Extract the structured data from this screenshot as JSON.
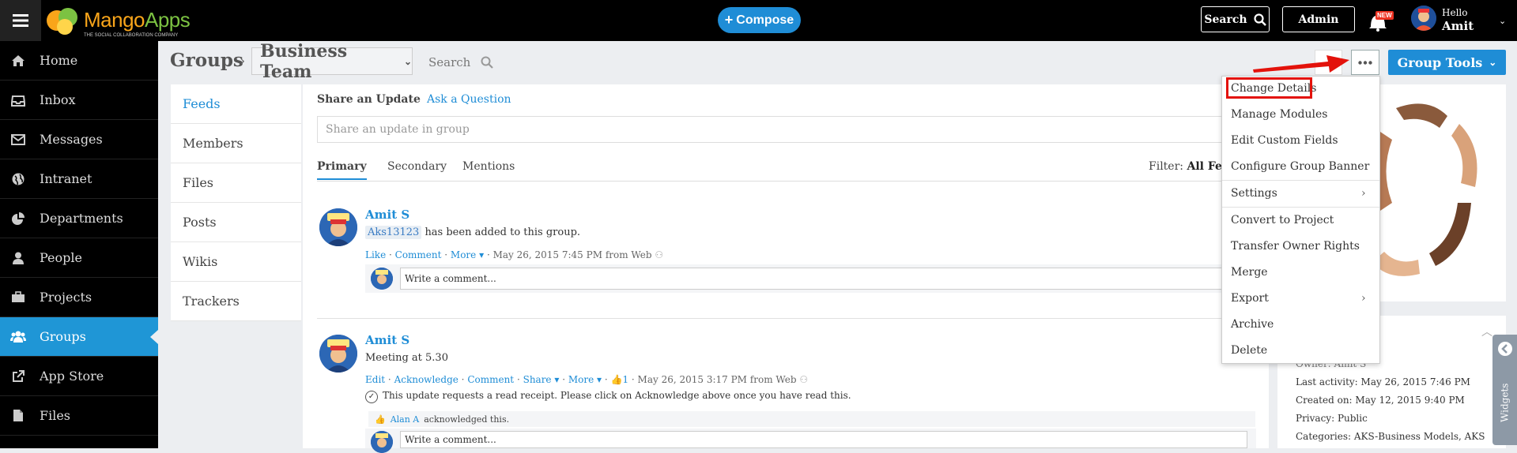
{
  "app": {
    "logo_text_a": "Mango",
    "logo_text_b": "Apps",
    "logo_tagline": "THE SOCIAL COLLABORATION COMPANY",
    "compose_label": "Compose",
    "search_label": "Search",
    "admin_label": "Admin",
    "notification_badge": "NEW",
    "hello": "Hello",
    "user_name": "Amit"
  },
  "sidebar": {
    "items": [
      {
        "label": "Home",
        "icon": "home-icon"
      },
      {
        "label": "Inbox",
        "icon": "inbox-icon"
      },
      {
        "label": "Messages",
        "icon": "envelope-icon"
      },
      {
        "label": "Intranet",
        "icon": "globe-icon"
      },
      {
        "label": "Departments",
        "icon": "pie-chart-icon"
      },
      {
        "label": "People",
        "icon": "person-icon"
      },
      {
        "label": "Projects",
        "icon": "briefcase-icon"
      },
      {
        "label": "Groups",
        "icon": "users-icon"
      },
      {
        "label": "App Store",
        "icon": "external-link-icon"
      },
      {
        "label": "Files",
        "icon": "file-icon"
      }
    ],
    "active": "Groups"
  },
  "header": {
    "breadcrumb_root": "Groups",
    "breadcrumb_sep": "›",
    "group_name": "Business Team",
    "search_label": "Search",
    "group_tools_label": "Group Tools"
  },
  "group_nav": {
    "items": [
      "Feeds",
      "Members",
      "Files",
      "Posts",
      "Wikis",
      "Trackers"
    ]
  },
  "feed": {
    "share_tab": "Share an Update",
    "ask_tab": "Ask a Question",
    "share_placeholder": "Share an update in group",
    "tabs": [
      "Primary",
      "Secondary",
      "Mentions"
    ],
    "filter_label": "Filter:",
    "filter_value": "All Feeds",
    "comment_placeholder": "Write a comment...",
    "posts": [
      {
        "author": "Amit S",
        "tag": "Aks13123",
        "text": "has been added to this group.",
        "actions": [
          "Like",
          "Comment",
          "More"
        ],
        "timestamp": "May 26, 2015 7:45 PM",
        "source": "from Web"
      },
      {
        "author": "Amit S",
        "text": "Meeting at 5.30",
        "actions": [
          "Edit",
          "Acknowledge",
          "Comment",
          "Share",
          "More"
        ],
        "like_count": "1",
        "timestamp": "May 26, 2015 3:17 PM",
        "source": "from Web",
        "receipt_text": "This update requests a read receipt. Please click on Acknowledge above once you have read this.",
        "ack_user": "Alan A",
        "ack_text": "acknowledged this."
      }
    ]
  },
  "about": {
    "owner": "Owner: Amit S",
    "last_activity": "Last activity: May 26, 2015 7:46 PM",
    "created_on": "Created on: May 12, 2015 9:40 PM",
    "privacy": "Privacy: Public",
    "categories": "Categories: AKS-Business Models, AKS"
  },
  "widgets_label": "Widgets",
  "menu": {
    "items": [
      {
        "label": "Change Details",
        "submenu": false
      },
      {
        "label": "Manage Modules",
        "submenu": false
      },
      {
        "label": "Edit Custom Fields",
        "submenu": false
      },
      {
        "label": "Configure Group Banner",
        "submenu": false
      },
      {
        "label": "Settings",
        "submenu": true
      },
      {
        "label": "Convert to Project",
        "submenu": false
      },
      {
        "label": "Transfer Owner Rights",
        "submenu": false
      },
      {
        "label": "Merge",
        "submenu": false
      },
      {
        "label": "Export",
        "submenu": true
      },
      {
        "label": "Archive",
        "submenu": false
      },
      {
        "label": "Delete",
        "submenu": false
      }
    ]
  },
  "colors": {
    "accent": "#1f8dd6",
    "highlight": "#e3120b"
  }
}
